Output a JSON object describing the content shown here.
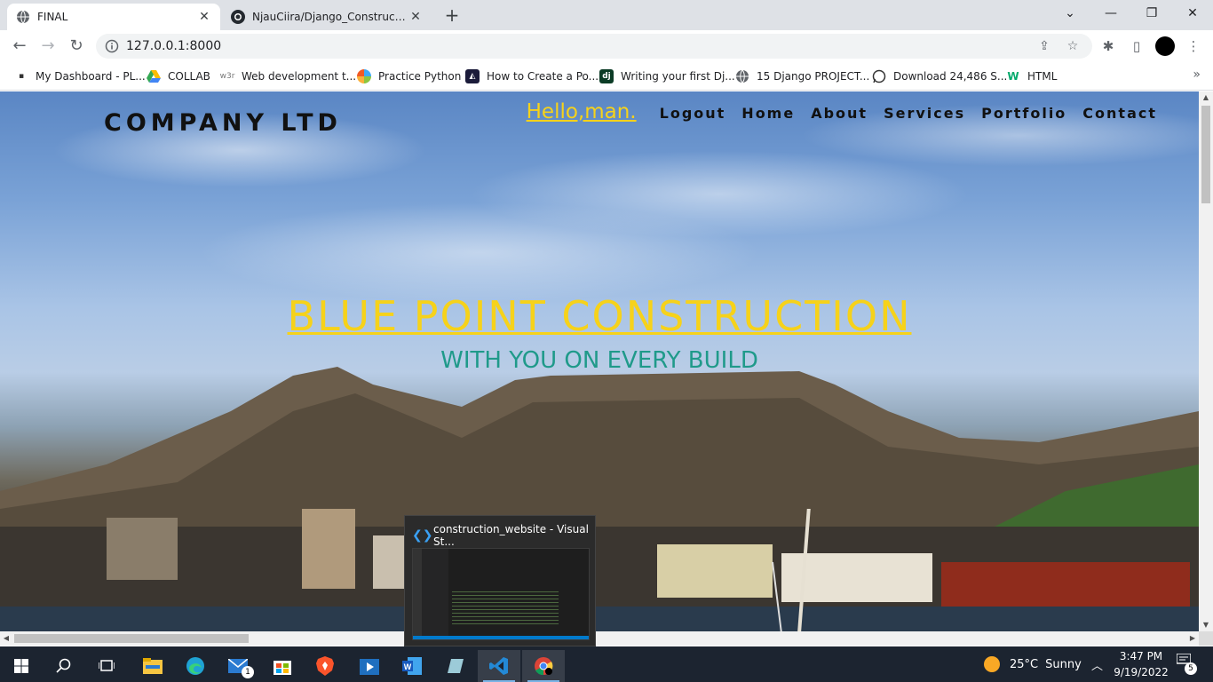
{
  "browser": {
    "tabs": [
      {
        "title": "FINAL",
        "active": true
      },
      {
        "title": "NjauCiira/Django_Construction_w",
        "active": false
      }
    ],
    "new_tab": "+",
    "window_controls": {
      "minimize": "—",
      "restore": "❐",
      "close": "✕",
      "dropdown": "⌄"
    },
    "url": "127.0.0.1:8000",
    "bookmarks": [
      {
        "label": "My Dashboard - PL...",
        "icon": "dashboard-icon"
      },
      {
        "label": "COLLAB",
        "icon": "colab-drive-icon"
      },
      {
        "label": "Web development t...",
        "icon": "w3r-icon",
        "icon_text": "w3r"
      },
      {
        "label": "Practice Python",
        "icon": "practice-python-icon"
      },
      {
        "label": "How to Create a Po...",
        "icon": "web-icon"
      },
      {
        "label": "Writing your first Dj...",
        "icon": "django-icon",
        "icon_text": "dj"
      },
      {
        "label": "15 Django PROJECT...",
        "icon": "globe-icon"
      },
      {
        "label": "Download 24,486 S...",
        "icon": "whatsapp-icon"
      },
      {
        "label": "HTML",
        "icon": "w3schools-icon"
      }
    ],
    "more": "»"
  },
  "page": {
    "brand": "COMPANY LTD",
    "greeting": "Hello,man.",
    "nav": [
      "Logout",
      "Home",
      "About",
      "Services",
      "Portfolio",
      "Contact"
    ],
    "hero_title": "BLUE POINT CONSTRUCTION",
    "hero_subtitle": "WITH YOU ON EVERY BUILD",
    "colors": {
      "accent": "#f6d21a",
      "teal": "#1f9a8a",
      "text": "#111111"
    }
  },
  "vscode_preview": {
    "title": "construction_website - Visual St..."
  },
  "taskbar": {
    "weather": {
      "temp": "25°C",
      "condition": "Sunny"
    },
    "time": "3:47 PM",
    "date": "9/19/2022",
    "notifications": "5",
    "mail_badge": "1"
  }
}
